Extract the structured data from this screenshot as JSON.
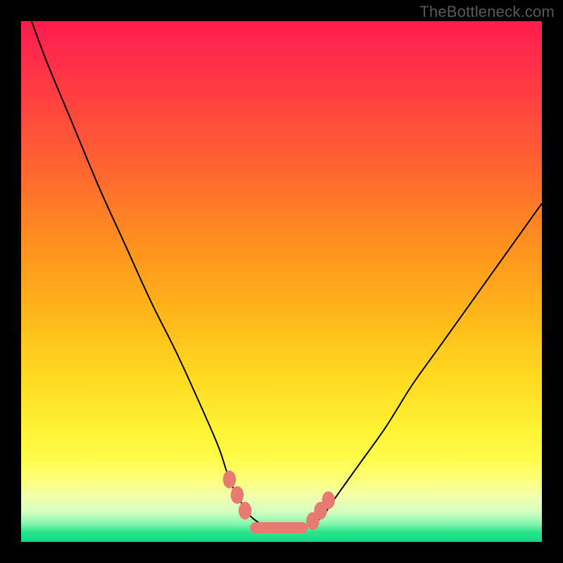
{
  "attribution": "TheBottleneck.com",
  "chart_data": {
    "type": "line",
    "title": "",
    "xlabel": "",
    "ylabel": "",
    "xlim": [
      0,
      100
    ],
    "ylim": [
      0,
      100
    ],
    "series": [
      {
        "name": "bottleneck-curve",
        "x": [
          2,
          5,
          10,
          15,
          20,
          25,
          30,
          35,
          38,
          40,
          42,
          44,
          46,
          48,
          50,
          52,
          54,
          56,
          58,
          60,
          65,
          70,
          75,
          80,
          85,
          90,
          95,
          100
        ],
        "y": [
          100,
          92,
          80,
          68,
          57,
          46,
          36,
          25,
          18,
          12,
          8,
          5,
          3.5,
          2.8,
          2.5,
          2.5,
          2.8,
          3.5,
          5,
          8,
          15,
          22,
          30,
          37,
          44,
          51,
          58,
          65
        ]
      }
    ],
    "markers": {
      "name": "highlight-markers",
      "points": [
        {
          "x": 40,
          "y": 12
        },
        {
          "x": 41.5,
          "y": 9
        },
        {
          "x": 43,
          "y": 6
        },
        {
          "x": 56,
          "y": 4
        },
        {
          "x": 57.5,
          "y": 6
        },
        {
          "x": 59,
          "y": 8
        }
      ],
      "band": {
        "x_start": 44,
        "x_end": 55,
        "y": 2.7
      }
    },
    "background_gradient": {
      "top": "#ff1a4d",
      "mid": "#ffd820",
      "bottom": "#10dc82"
    }
  }
}
